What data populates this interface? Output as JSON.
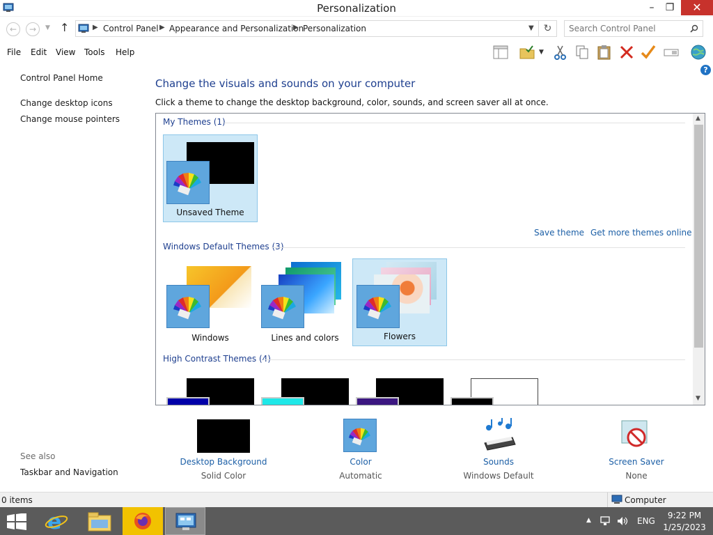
{
  "window": {
    "title": "Personalization",
    "controls": {
      "minimize": "–",
      "maximize": "❐",
      "close": "✕"
    }
  },
  "address_bar": {
    "breadcrumbs": [
      "Control Panel",
      "Appearance and Personalization",
      "Personalization"
    ],
    "search_placeholder": "Search Control Panel"
  },
  "menu": [
    "File",
    "Edit",
    "View",
    "Tools",
    "Help"
  ],
  "toolbar_icons": [
    "layout-icon",
    "folder-check-icon",
    "dropdown-arrow-icon",
    "cut-icon",
    "copy-icon",
    "paste-icon",
    "delete-icon",
    "properties-check-icon",
    "rename-icon",
    "globe-icon"
  ],
  "sidebar": {
    "home": "Control Panel Home",
    "links": [
      "Change desktop icons",
      "Change mouse pointers"
    ],
    "see_also_label": "See also",
    "see_also_links": [
      "Taskbar and Navigation"
    ]
  },
  "main": {
    "heading": "Change the visuals and sounds on your computer",
    "subheading": "Click a theme to change the desktop background, color, sounds, and screen saver all at once.",
    "groups": {
      "my_themes": {
        "title": "My Themes (1)",
        "themes": [
          "Unsaved Theme"
        ]
      },
      "default_themes": {
        "title": "Windows Default Themes (3)",
        "themes": [
          "Windows",
          "Lines and colors",
          "Flowers"
        ]
      },
      "high_contrast": {
        "title": "High Contrast Themes (4)"
      }
    },
    "links": {
      "save_theme": "Save theme",
      "get_more": "Get more themes online"
    }
  },
  "settings": [
    {
      "title": "Desktop Background",
      "value": "Solid Color"
    },
    {
      "title": "Color",
      "value": "Automatic"
    },
    {
      "title": "Sounds",
      "value": "Windows Default"
    },
    {
      "title": "Screen Saver",
      "value": "None"
    }
  ],
  "statusbar": {
    "items": "0 items",
    "location": "Computer"
  },
  "taskbar": {
    "apps": [
      "start-icon",
      "internet-explorer-icon",
      "file-explorer-icon",
      "firefox-icon",
      "control-panel-icon"
    ],
    "language": "ENG",
    "time": "9:22 PM",
    "date": "1/25/2023"
  },
  "colors": {
    "link": "#1c5fa6",
    "heading": "#1e3f8f",
    "selection": "#cde8f7",
    "close_button": "#c7322c",
    "taskbar": "#5b5b5b",
    "palette_tile": "#5fa6dd"
  }
}
